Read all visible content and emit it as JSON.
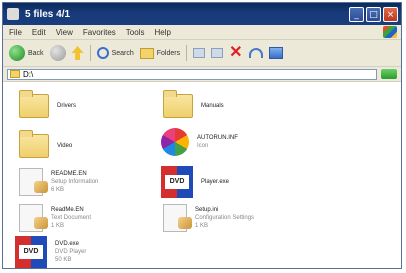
{
  "window": {
    "title": "5 files 4/1"
  },
  "menu": [
    "File",
    "Edit",
    "View",
    "Favorites",
    "Tools",
    "Help"
  ],
  "toolbar": {
    "back_label": "Back",
    "search_label": "Search",
    "folders_label": "Folders"
  },
  "address": {
    "value": "D:\\"
  },
  "items": [
    {
      "name": "Drivers",
      "sub": ""
    },
    {
      "name": "Manuals",
      "sub": ""
    },
    {
      "name": "Video",
      "sub": ""
    },
    {
      "name": "AUTORUN.INF",
      "sub": "Icon"
    },
    {
      "name": "README.EN",
      "sub": "Setup Information\n6 KB"
    },
    {
      "name": "Player.exe",
      "sub": ""
    },
    {
      "name": "ReadMe.EN",
      "sub": "Text Document\n1 KB"
    },
    {
      "name": "Setup.ini",
      "sub": "Configuration Settings\n1 KB"
    },
    {
      "name": "DVD.exe",
      "sub": "DVD Player\n50 KB"
    }
  ]
}
